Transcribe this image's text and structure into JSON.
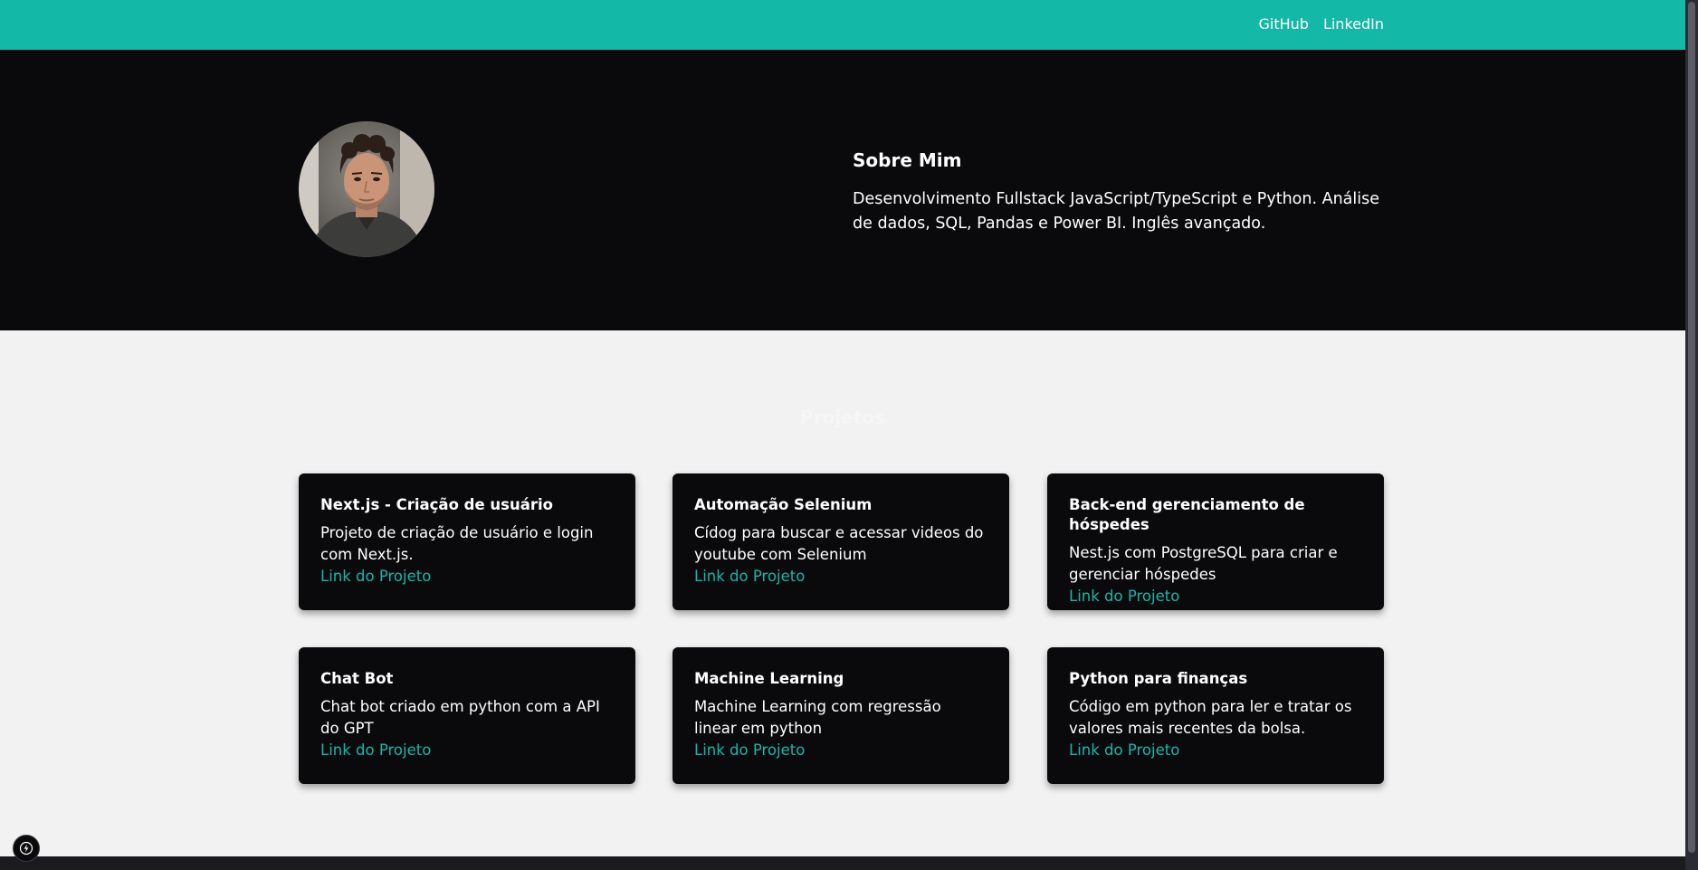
{
  "nav": {
    "links": [
      {
        "label": "GitHub"
      },
      {
        "label": "LinkedIn"
      }
    ]
  },
  "about": {
    "title": "Sobre Mim",
    "text": "Desenvolvimento Fullstack JavaScript/TypeScript e Python. Análise de dados, SQL, Pandas e Power BI. Inglês avançado."
  },
  "projects": {
    "title": "Projetos",
    "items": [
      {
        "title": "Next.js - Criação de usuário",
        "description": "Projeto de criação de usuário e login com Next.js.",
        "link": "Link do Projeto"
      },
      {
        "title": "Automação Selenium",
        "description": "Cídog para buscar e acessar videos do youtube com Selenium",
        "link": "Link do Projeto"
      },
      {
        "title": "Back-end gerenciamento de hóspedes",
        "description": "Nest.js com PostgreSQL para criar e gerenciar hóspedes",
        "link": "Link do Projeto"
      },
      {
        "title": "Chat Bot",
        "description": "Chat bot criado em python com a API do GPT",
        "link": "Link do Projeto"
      },
      {
        "title": "Machine Learning",
        "description": "Machine Learning com regressão linear em python",
        "link": "Link do Projeto"
      },
      {
        "title": "Python para finanças",
        "description": "Código em python para ler e tratar os valores mais recentes da bolsa.",
        "link": "Link do Projeto"
      }
    ]
  },
  "colors": {
    "accent": "#14b8a6",
    "dark": "#0a0a0c",
    "light_bg": "#f2f2f2"
  },
  "icons": {
    "avatar": "profile-photo",
    "dev_badge": "lightning-bolt-icon"
  }
}
